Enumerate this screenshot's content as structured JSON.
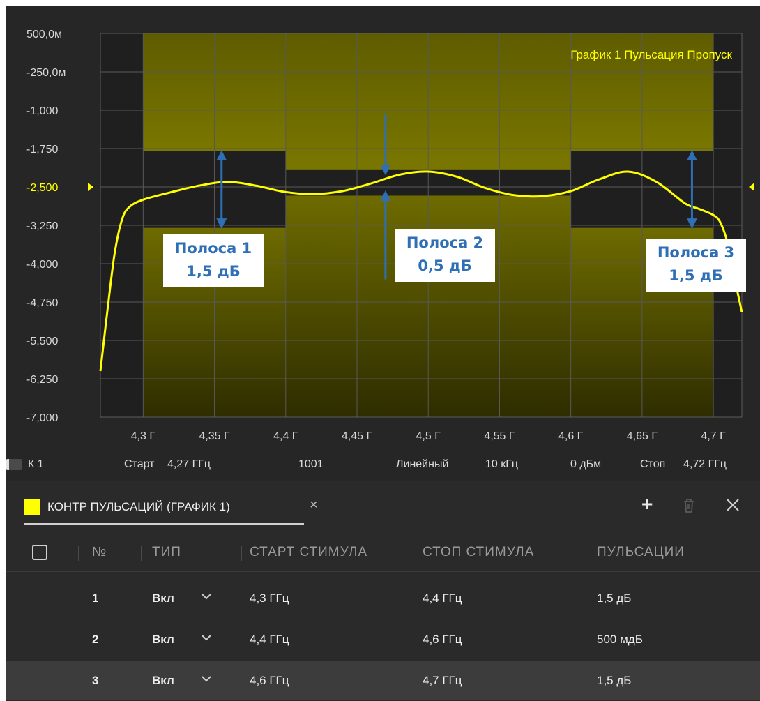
{
  "chart_data": {
    "type": "line",
    "title": "График  1  Пульсация Пропуск",
    "y_ticks": [
      "500,0м",
      "-250,0м",
      "-1,000",
      "-1,750",
      "-2,500",
      "-3,250",
      "-4,000",
      "-4,750",
      "-5,500",
      "-6,250",
      "-7,000"
    ],
    "x_ticks": [
      "4,3 Г",
      "4,35 Г",
      "4,4 Г",
      "4,45 Г",
      "4,5 Г",
      "4,55 Г",
      "4,6 Г",
      "4,65 Г",
      "4,7 Г"
    ],
    "xlim": [
      4.27,
      4.72
    ],
    "ylim": [
      -7.0,
      0.5
    ],
    "reference_level": -2.5,
    "grid": true,
    "series": [
      {
        "color": "#ffff00",
        "x": [
          4.27,
          4.275,
          4.28,
          4.285,
          4.29,
          4.3,
          4.32,
          4.34,
          4.36,
          4.38,
          4.4,
          4.42,
          4.44,
          4.46,
          4.48,
          4.5,
          4.52,
          4.54,
          4.56,
          4.58,
          4.6,
          4.62,
          4.64,
          4.66,
          4.68,
          4.69,
          4.7,
          4.705,
          4.71,
          4.715,
          4.72
        ],
        "y": [
          -6.1,
          -4.9,
          -3.8,
          -3.15,
          -2.9,
          -2.75,
          -2.6,
          -2.47,
          -2.4,
          -2.48,
          -2.6,
          -2.64,
          -2.58,
          -2.43,
          -2.26,
          -2.2,
          -2.3,
          -2.52,
          -2.66,
          -2.68,
          -2.58,
          -2.35,
          -2.2,
          -2.4,
          -2.82,
          -2.93,
          -3.05,
          -3.2,
          -3.6,
          -4.3,
          -4.95
        ]
      }
    ],
    "ripple_bands": [
      {
        "x_start": 4.3,
        "x_stop": 4.4,
        "upper": -1.8,
        "lower": -3.3
      },
      {
        "x_start": 4.4,
        "x_stop": 4.6,
        "upper": -2.17,
        "lower": -2.67
      },
      {
        "x_start": 4.6,
        "x_stop": 4.7,
        "upper": -1.8,
        "lower": -3.3
      }
    ],
    "annotations": [
      {
        "line1": "Полоса 1",
        "line2": "1,5 дБ"
      },
      {
        "line1": "Полоса 2",
        "line2": "0,5 дБ"
      },
      {
        "line1": "Полоса 3",
        "line2": "1,5 дБ"
      }
    ],
    "colors": {
      "trace": "#ffff00",
      "limit_fill": "#6b6900",
      "limit_dark": "#4a4800",
      "arrow": "#2e6fb5",
      "grid": "#595959"
    }
  },
  "status_bar": {
    "channel": "К 1",
    "start_label": "Старт",
    "start_value": "4,27 ГГц",
    "points": "1001",
    "sweep_type": "Линейный",
    "if_bw": "10 кГц",
    "power": "0 дБм",
    "stop_label": "Стоп",
    "stop_value": "4,72 ГГц"
  },
  "panel": {
    "tab_title": "КОНТР ПУЛЬСАЦИЙ (ГРАФИК 1)",
    "tab_close": "×",
    "add": "+",
    "swatch_color": "#ffff00",
    "columns": [
      "№",
      "ТИП",
      "СТАРТ СТИМУЛА",
      "СТОП СТИМУЛА",
      "ПУЛЬСАЦИИ"
    ],
    "rows": [
      {
        "n": "1",
        "type": "Вкл",
        "start": "4,3 ГГц",
        "stop": "4,4 ГГц",
        "ripple": "1,5 дБ"
      },
      {
        "n": "2",
        "type": "Вкл",
        "start": "4,4 ГГц",
        "stop": "4,6 ГГц",
        "ripple": "500 мдБ"
      },
      {
        "n": "3",
        "type": "Вкл",
        "start": "4,6 ГГц",
        "stop": "4,7 ГГц",
        "ripple": "1,5 дБ"
      }
    ]
  }
}
